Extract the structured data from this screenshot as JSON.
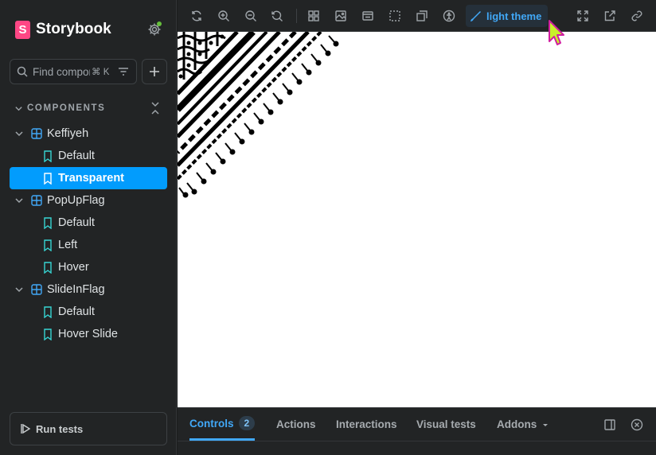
{
  "brand": {
    "logo_letter": "S",
    "name": "Storybook"
  },
  "search": {
    "placeholder": "Find components",
    "shortcut": "⌘ K"
  },
  "sidebar": {
    "section_label": "COMPONENTS",
    "items": [
      {
        "type": "component",
        "label": "Keffiyeh"
      },
      {
        "type": "story",
        "label": "Default"
      },
      {
        "type": "story",
        "label": "Transparent",
        "selected": true
      },
      {
        "type": "component",
        "label": "PopUpFlag"
      },
      {
        "type": "story",
        "label": "Default"
      },
      {
        "type": "story",
        "label": "Left"
      },
      {
        "type": "story",
        "label": "Hover"
      },
      {
        "type": "component",
        "label": "SlideInFlag"
      },
      {
        "type": "story",
        "label": "Default"
      },
      {
        "type": "story",
        "label": "Hover Slide"
      }
    ],
    "run_tests_label": "Run tests"
  },
  "toolbar": {
    "theme_label": "light theme",
    "icons": [
      "remount-icon",
      "zoom-in-icon",
      "zoom-out-icon",
      "zoom-reset-icon",
      "grid-icon",
      "background-icon",
      "viewport-icon",
      "outline-icon",
      "measure-icon",
      "accessibility-icon",
      "fullscreen-icon",
      "open-new-tab-icon",
      "copy-link-icon"
    ]
  },
  "addons": {
    "tabs": [
      {
        "label": "Controls",
        "badge": "2",
        "active": true
      },
      {
        "label": "Actions"
      },
      {
        "label": "Interactions"
      },
      {
        "label": "Visual tests"
      },
      {
        "label": "Addons"
      }
    ]
  },
  "colors": {
    "accent": "#029cfd",
    "brand": "#ff4785",
    "status_dot": "#66bf3c",
    "cursor": "#c8f02a"
  }
}
